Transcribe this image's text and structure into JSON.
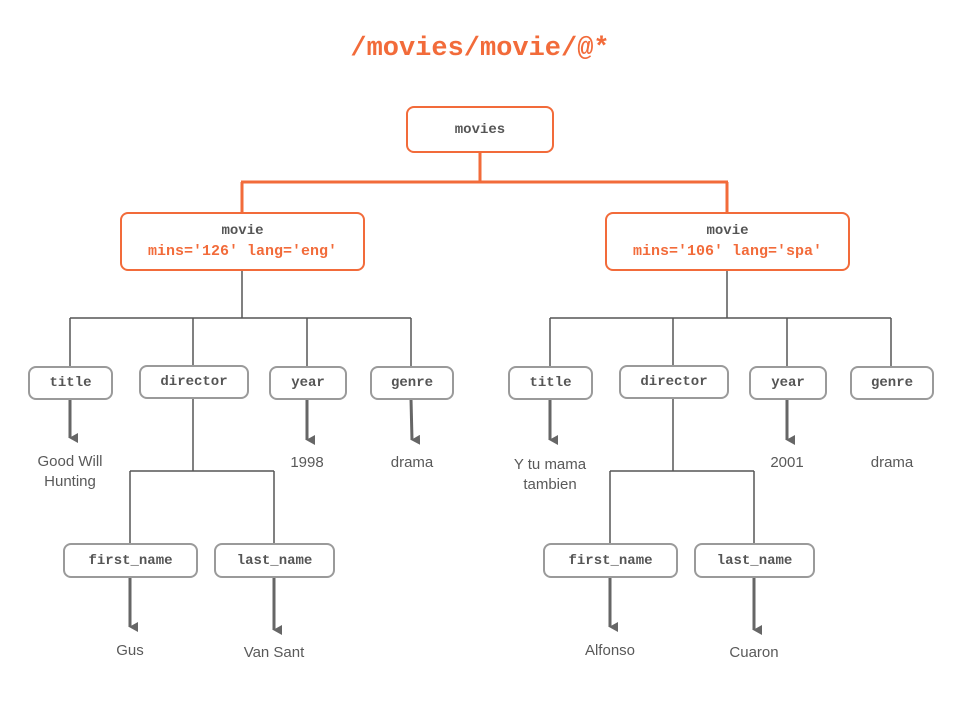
{
  "title": "/movies/movie/@*",
  "colors": {
    "accent": "#f26b3a",
    "line": "#555555",
    "box_border": "#9a9a9a",
    "text": "#595959"
  },
  "root": {
    "label": "movies"
  },
  "movies": [
    {
      "label": "movie",
      "attributes": "mins='126' lang='eng'",
      "title": {
        "label": "title",
        "value_line1": "Good Will",
        "value_line2": "Hunting"
      },
      "director": {
        "label": "director",
        "first_name": {
          "label": "first_name",
          "value": "Gus"
        },
        "last_name": {
          "label": "last_name",
          "value": "Van Sant"
        }
      },
      "year": {
        "label": "year",
        "value": "1998"
      },
      "genre": {
        "label": "genre",
        "value": "drama"
      }
    },
    {
      "label": "movie",
      "attributes": "mins='106' lang='spa'",
      "title": {
        "label": "title",
        "value_line1": "Y tu mama",
        "value_line2": "tambien"
      },
      "director": {
        "label": "director",
        "first_name": {
          "label": "first_name",
          "value": "Alfonso"
        },
        "last_name": {
          "label": "last_name",
          "value": "Cuaron"
        }
      },
      "year": {
        "label": "year",
        "value": "2001"
      },
      "genre": {
        "label": "genre",
        "value": "drama"
      }
    }
  ]
}
